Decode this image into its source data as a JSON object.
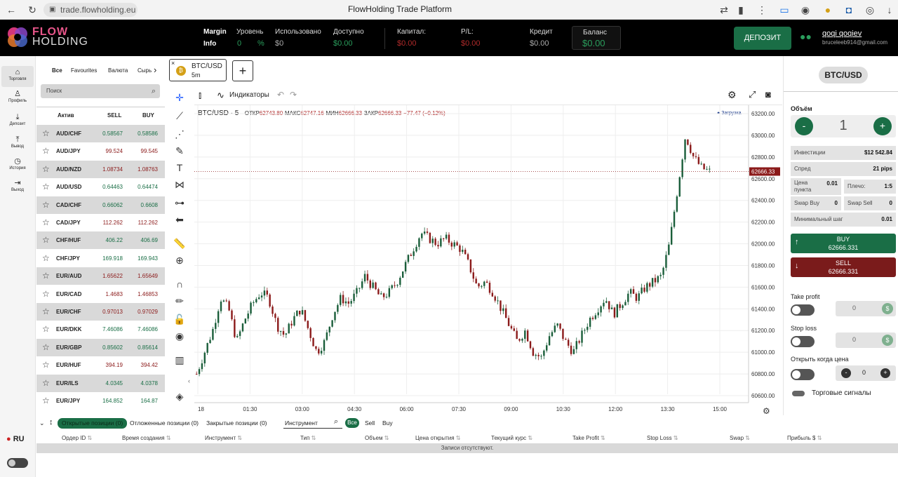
{
  "browser": {
    "url": "trade.flowholding.eu",
    "title": "FlowHolding Trade Platform"
  },
  "brand": {
    "top": "FLOW",
    "bottom": "HOLDING"
  },
  "header": {
    "margin_label": "Margin",
    "info_label": "Info",
    "level_label": "Уровень",
    "level_value": "0",
    "level_unit": "%",
    "used_label": "Использовано",
    "used_value": "$0",
    "available_label": "Доступно",
    "available_value": "$0.00",
    "capital_label": "Капитал:",
    "capital_value": "$0.00",
    "pl_label": "P/L:",
    "pl_value": "$0.00",
    "credit_label": "Кредит",
    "credit_value": "$0.00",
    "balance_label": "Баланс",
    "balance_value": "$0.00",
    "deposit_button": "ДЕПОЗИТ",
    "user_name": "qoqi qoqiev",
    "user_email": "bruceleeb914@gmail.com"
  },
  "nav": [
    {
      "label": "Торговля",
      "icon": "home-icon"
    },
    {
      "label": "Профиль",
      "icon": "user-icon"
    },
    {
      "label": "Депозит",
      "icon": "download-icon"
    },
    {
      "label": "Вывод",
      "icon": "upload-icon"
    },
    {
      "label": "История",
      "icon": "clock-icon"
    },
    {
      "label": "Выход",
      "icon": "logout-icon"
    }
  ],
  "language": "RU",
  "market": {
    "categories": [
      "Все",
      "Favourites",
      "Валюта",
      "Сырь"
    ],
    "search_placeholder": "Поиск",
    "headers": {
      "asset": "Актив",
      "sell": "SELL",
      "buy": "BUY"
    },
    "rows": [
      {
        "name": "AUD/CHF",
        "sell": "0.58567",
        "buy": "0.58586",
        "dir": "up"
      },
      {
        "name": "AUD/JPY",
        "sell": "99.524",
        "buy": "99.545",
        "dir": "down"
      },
      {
        "name": "AUD/NZD",
        "sell": "1.08734",
        "buy": "1.08763",
        "dir": "down"
      },
      {
        "name": "AUD/USD",
        "sell": "0.64463",
        "buy": "0.64474",
        "dir": "up"
      },
      {
        "name": "CAD/CHF",
        "sell": "0.66062",
        "buy": "0.6608",
        "dir": "up"
      },
      {
        "name": "CAD/JPY",
        "sell": "112.262",
        "buy": "112.262",
        "dir": "down"
      },
      {
        "name": "CHF/HUF",
        "sell": "406.22",
        "buy": "406.69",
        "dir": "up"
      },
      {
        "name": "CHF/JPY",
        "sell": "169.918",
        "buy": "169.943",
        "dir": "up"
      },
      {
        "name": "EUR/AUD",
        "sell": "1.65622",
        "buy": "1.65649",
        "dir": "down"
      },
      {
        "name": "EUR/CAD",
        "sell": "1.4683",
        "buy": "1.46853",
        "dir": "down"
      },
      {
        "name": "EUR/CHF",
        "sell": "0.97013",
        "buy": "0.97029",
        "dir": "down"
      },
      {
        "name": "EUR/DKK",
        "sell": "7.46086",
        "buy": "7.46086",
        "dir": "up"
      },
      {
        "name": "EUR/GBP",
        "sell": "0.85602",
        "buy": "0.85614",
        "dir": "up"
      },
      {
        "name": "EUR/HUF",
        "sell": "394.19",
        "buy": "394.42",
        "dir": "down"
      },
      {
        "name": "EUR/ILS",
        "sell": "4.0345",
        "buy": "4.0378",
        "dir": "up"
      },
      {
        "name": "EUR/JPY",
        "sell": "164.852",
        "buy": "164.87",
        "dir": "up"
      }
    ]
  },
  "chart_tab": {
    "symbol": "BTC/USD",
    "interval": "5m"
  },
  "chart_toolbar": {
    "indicators": "Индикаторы"
  },
  "chart_info": {
    "symbol": "BTC/USD · 5",
    "open_label": "ОТКР",
    "open": "62743.80",
    "high_label": "МАКС",
    "high": "62747.16",
    "low_label": "МИН",
    "low": "62666.33",
    "close_label": "ЗАКР",
    "close": "62666.33",
    "change": "−77.47 (−0.12%)",
    "loading": "Загрузка"
  },
  "chart_data": {
    "type": "candlestick",
    "y_ticks": [
      "63200.00",
      "63000.00",
      "62800.00",
      "62600.00",
      "62400.00",
      "62200.00",
      "62000.00",
      "61800.00",
      "61600.00",
      "61400.00",
      "61200.00",
      "61000.00",
      "60800.00",
      "60600.00"
    ],
    "x_ticks": [
      "18",
      "01:30",
      "03:00",
      "04:30",
      "06:00",
      "07:30",
      "09:00",
      "10:30",
      "12:00",
      "13:30",
      "15:00"
    ],
    "ylim": [
      60600,
      63200
    ],
    "last_price": "62666.33",
    "closes": [
      60800,
      61000,
      61200,
      61500,
      61400,
      61100,
      61300,
      61450,
      61550,
      61500,
      61250,
      61150,
      61300,
      61400,
      61200,
      61000,
      61100,
      61350,
      61500,
      61450,
      61550,
      61700,
      61600,
      61500,
      61550,
      61650,
      61800,
      61950,
      62100,
      62050,
      62000,
      62050,
      62000,
      61950,
      61800,
      61600,
      61650,
      61550,
      61400,
      61250,
      61100,
      61200,
      61000,
      60950,
      61150,
      61250,
      61100,
      61000,
      61150,
      61300,
      61400,
      61500,
      61350,
      61450,
      61550,
      61500,
      61600,
      61650,
      61700,
      62000,
      62500,
      63000,
      62800,
      62700,
      62666
    ]
  },
  "order": {
    "symbol": "BTC/USD",
    "volume_label": "Объём",
    "volume": "1",
    "investment_label": "Инвестиции",
    "investment": "$12 542.84",
    "spread_label": "Спред",
    "spread": "21 pips",
    "pip_label": "Цена пункта",
    "pip": "0.01",
    "leverage_label": "Плечо:",
    "leverage": "1:5",
    "swap_buy_label": "Swap Buy",
    "swap_buy": "0",
    "swap_sell_label": "Swap Sell",
    "swap_sell": "0",
    "min_step_label": "Минимальный шаг",
    "min_step": "0.01",
    "buy_label": "BUY",
    "buy_price": "62666.331",
    "sell_label": "SELL",
    "sell_price": "62666.331",
    "tp_label": "Take profit",
    "tp_value": "0",
    "sl_label": "Stop loss",
    "sl_value": "0",
    "open_when_label": "Открыть когда цена",
    "open_when_value": "0",
    "signals_label": "Торговые сигналы"
  },
  "bottom": {
    "tabs": [
      "Открытые позиции (0)",
      "Отложенные позиции (0)",
      "Закрытые позиции (0)"
    ],
    "instrument_label": "Инструмент",
    "filter_all": "Все",
    "filter_sell": "Sell",
    "filter_buy": "Buy",
    "columns": [
      "Ордер ID",
      "Время создания",
      "Инструмент",
      "Тип",
      "Объем",
      "Цена открытия",
      "Текущий курс",
      "Take Profit",
      "Stop Loss",
      "Swap",
      "Прибыль $"
    ],
    "empty": "Записи отсутствуют."
  }
}
